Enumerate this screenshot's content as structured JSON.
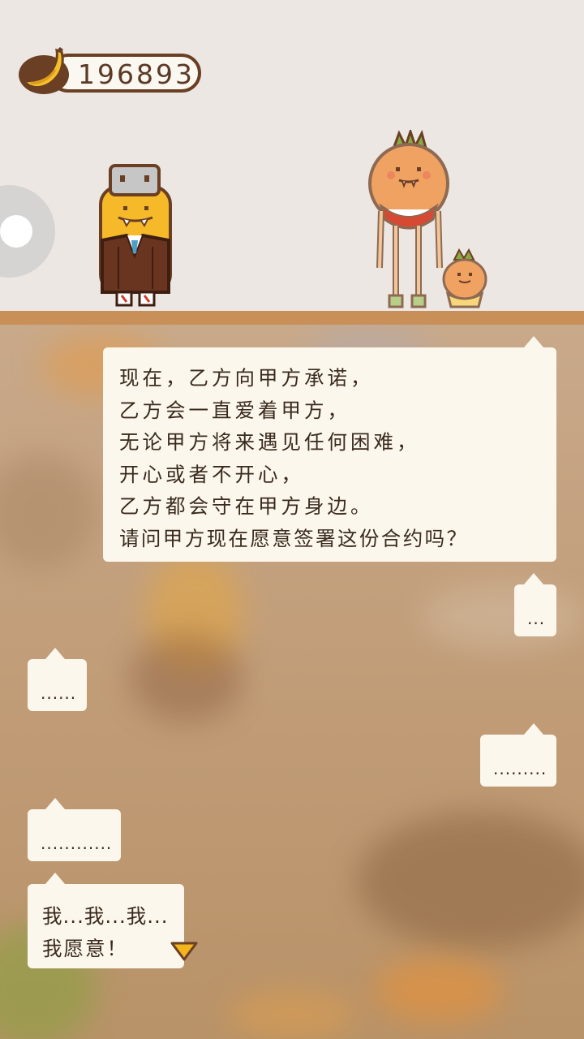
{
  "hud": {
    "banana_count": "196893",
    "banana_icon": "banana-icon",
    "side_button_icon": "circle-button-icon"
  },
  "characters": {
    "left": "yellow-suited-character",
    "right_tall": "orange-tall-character",
    "right_small": "small-orange-character"
  },
  "dialog": {
    "main_lines": [
      "现在，乙方向甲方承诺，",
      "乙方会一直爱着甲方，",
      "无论甲方将来遇见任何困难，",
      "开心或者不开心，",
      "乙方都会守在甲方身边。",
      "请问甲方现在愿意签署这份合约吗？"
    ],
    "reply_1": "...",
    "reply_2": "......",
    "reply_3": ".........",
    "reply_4": "............",
    "final_lines": [
      "我...我...我...",
      "我愿意！"
    ],
    "next_icon": "triangle-down-icon"
  },
  "colors": {
    "background": "#ece7e3",
    "floor": "#c98f58",
    "bubble": "#fcf7ec",
    "text": "#3a2a1e",
    "counter_border": "#6b3f24",
    "next_arrow": "#f2b51e"
  }
}
